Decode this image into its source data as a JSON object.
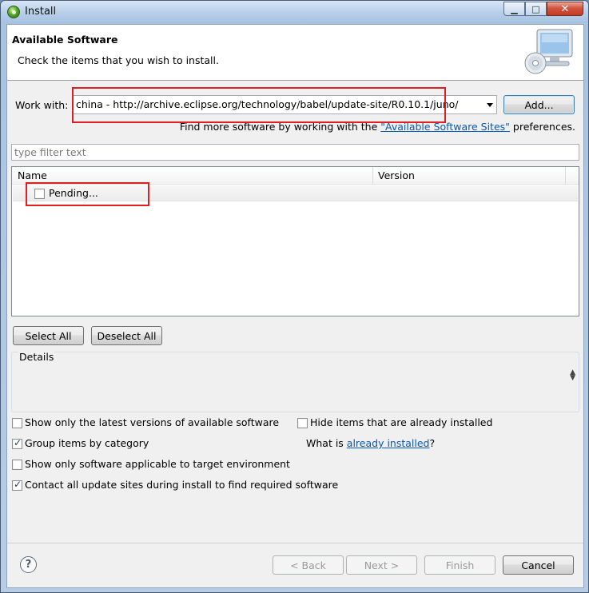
{
  "window": {
    "title": "Install",
    "minimize": "▁",
    "maximize": "□",
    "close": "✕"
  },
  "header": {
    "title": "Available Software",
    "description": "Check the items that you wish to install."
  },
  "work_with": {
    "label": "Work with:",
    "value": "china - http://archive.eclipse.org/technology/babel/update-site/R0.10.1/juno/",
    "add_button": "Add...",
    "find_more_prefix": "Find more software by working with the",
    "find_more_link": "\"Available Software Sites\"",
    "find_more_suffix": "preferences."
  },
  "filter": {
    "placeholder": "type filter text"
  },
  "tree": {
    "columns": [
      "Name",
      "Version"
    ],
    "rows": [
      {
        "label": "Pending...",
        "checked": false
      }
    ]
  },
  "selection_buttons": {
    "select_all": "Select All",
    "deselect_all": "Deselect All"
  },
  "details": {
    "label": "Details"
  },
  "options": {
    "latest_versions": {
      "label": "Show only the latest versions of available software",
      "checked": false
    },
    "group_by_category": {
      "label": "Group items by category",
      "checked": true
    },
    "applicable_target": {
      "label": "Show only software applicable to target environment",
      "checked": false
    },
    "contact_sites": {
      "label": "Contact all update sites during install to find required software",
      "checked": true
    },
    "hide_installed": {
      "label": "Hide items that are already installed",
      "checked": false
    },
    "what_is_prefix": "What is",
    "what_is_link": "already installed",
    "what_is_suffix": "?"
  },
  "footer": {
    "help": "?",
    "back": "< Back",
    "next": "Next >",
    "finish": "Finish",
    "cancel": "Cancel"
  },
  "colors": {
    "highlight_box": "#e02020",
    "link": "#0a58b5"
  }
}
